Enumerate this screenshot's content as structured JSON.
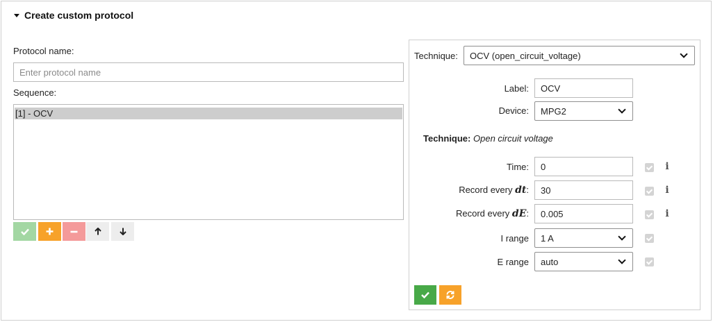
{
  "section": {
    "title": "Create custom protocol"
  },
  "protocol": {
    "name_label": "Protocol name:",
    "name_placeholder": "Enter protocol name",
    "sequence_label": "Sequence:",
    "sequence_items": [
      "[1] - OCV"
    ]
  },
  "sequence_buttons": {
    "confirm_icon": "check-icon",
    "add_icon": "plus-icon",
    "remove_icon": "minus-icon",
    "move_up_icon": "arrow-up-icon",
    "move_down_icon": "arrow-down-icon"
  },
  "technique_panel": {
    "technique_label": "Technique:",
    "technique_value": "OCV (open_circuit_voltage)",
    "label_label": "Label:",
    "label_value": "OCV",
    "device_label": "Device:",
    "device_value": "MPG2",
    "desc_prefix": "Technique:",
    "desc_value": "Open circuit voltage",
    "params": [
      {
        "label": "Time:",
        "value": "0",
        "checked": true,
        "info": true
      },
      {
        "label_prefix": "Record every ",
        "label_math": "dt",
        "label_suffix": ":",
        "value": "30",
        "checked": true,
        "info": true
      },
      {
        "label_prefix": "Record every ",
        "label_math": "dE",
        "label_suffix": ":",
        "value": "0.005",
        "checked": true,
        "info": true
      },
      {
        "label": "I range",
        "value": "1 A",
        "checked": true
      },
      {
        "label": "E range",
        "value": "auto",
        "checked": true
      }
    ]
  },
  "colors": {
    "confirm_light": "#a3d7a3",
    "add": "#f7a22a",
    "remove": "#f49a9a",
    "confirm": "#48a948",
    "reset": "#f7a22a"
  }
}
